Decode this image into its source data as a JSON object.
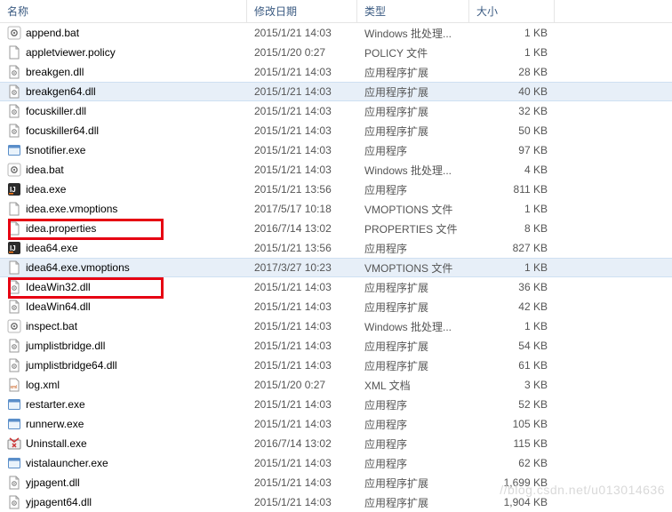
{
  "columns": {
    "name": "名称",
    "date": "修改日期",
    "type": "类型",
    "size": "大小"
  },
  "files": [
    {
      "name": "append.bat",
      "date": "2015/1/21 14:03",
      "type": "Windows 批处理...",
      "size": "1 KB",
      "icon": "cog"
    },
    {
      "name": "appletviewer.policy",
      "date": "2015/1/20 0:27",
      "type": "POLICY 文件",
      "size": "1 KB",
      "icon": "file"
    },
    {
      "name": "breakgen.dll",
      "date": "2015/1/21 14:03",
      "type": "应用程序扩展",
      "size": "28 KB",
      "icon": "dll"
    },
    {
      "name": "breakgen64.dll",
      "date": "2015/1/21 14:03",
      "type": "应用程序扩展",
      "size": "40 KB",
      "icon": "dll",
      "selected": true
    },
    {
      "name": "focuskiller.dll",
      "date": "2015/1/21 14:03",
      "type": "应用程序扩展",
      "size": "32 KB",
      "icon": "dll"
    },
    {
      "name": "focuskiller64.dll",
      "date": "2015/1/21 14:03",
      "type": "应用程序扩展",
      "size": "50 KB",
      "icon": "dll"
    },
    {
      "name": "fsnotifier.exe",
      "date": "2015/1/21 14:03",
      "type": "应用程序",
      "size": "97 KB",
      "icon": "exe"
    },
    {
      "name": "idea.bat",
      "date": "2015/1/21 14:03",
      "type": "Windows 批处理...",
      "size": "4 KB",
      "icon": "cog"
    },
    {
      "name": "idea.exe",
      "date": "2015/1/21 13:56",
      "type": "应用程序",
      "size": "811 KB",
      "icon": "idea"
    },
    {
      "name": "idea.exe.vmoptions",
      "date": "2017/5/17 10:18",
      "type": "VMOPTIONS 文件",
      "size": "1 KB",
      "icon": "file"
    },
    {
      "name": "idea.properties",
      "date": "2016/7/14 13:02",
      "type": "PROPERTIES 文件",
      "size": "8 KB",
      "icon": "file"
    },
    {
      "name": "idea64.exe",
      "date": "2015/1/21 13:56",
      "type": "应用程序",
      "size": "827 KB",
      "icon": "idea"
    },
    {
      "name": "idea64.exe.vmoptions",
      "date": "2017/3/27 10:23",
      "type": "VMOPTIONS 文件",
      "size": "1 KB",
      "icon": "file",
      "selected": true
    },
    {
      "name": "IdeaWin32.dll",
      "date": "2015/1/21 14:03",
      "type": "应用程序扩展",
      "size": "36 KB",
      "icon": "dll"
    },
    {
      "name": "IdeaWin64.dll",
      "date": "2015/1/21 14:03",
      "type": "应用程序扩展",
      "size": "42 KB",
      "icon": "dll"
    },
    {
      "name": "inspect.bat",
      "date": "2015/1/21 14:03",
      "type": "Windows 批处理...",
      "size": "1 KB",
      "icon": "cog"
    },
    {
      "name": "jumplistbridge.dll",
      "date": "2015/1/21 14:03",
      "type": "应用程序扩展",
      "size": "54 KB",
      "icon": "dll"
    },
    {
      "name": "jumplistbridge64.dll",
      "date": "2015/1/21 14:03",
      "type": "应用程序扩展",
      "size": "61 KB",
      "icon": "dll"
    },
    {
      "name": "log.xml",
      "date": "2015/1/20 0:27",
      "type": "XML 文档",
      "size": "3 KB",
      "icon": "xml"
    },
    {
      "name": "restarter.exe",
      "date": "2015/1/21 14:03",
      "type": "应用程序",
      "size": "52 KB",
      "icon": "exe"
    },
    {
      "name": "runnerw.exe",
      "date": "2015/1/21 14:03",
      "type": "应用程序",
      "size": "105 KB",
      "icon": "exe"
    },
    {
      "name": "Uninstall.exe",
      "date": "2016/7/14 13:02",
      "type": "应用程序",
      "size": "115 KB",
      "icon": "uninstall"
    },
    {
      "name": "vistalauncher.exe",
      "date": "2015/1/21 14:03",
      "type": "应用程序",
      "size": "62 KB",
      "icon": "exe"
    },
    {
      "name": "yjpagent.dll",
      "date": "2015/1/21 14:03",
      "type": "应用程序扩展",
      "size": "1,699 KB",
      "icon": "dll"
    },
    {
      "name": "yjpagent64.dll",
      "date": "2015/1/21 14:03",
      "type": "应用程序扩展",
      "size": "1,904 KB",
      "icon": "dll"
    }
  ],
  "watermark": "//blog.csdn.net/u013014636"
}
